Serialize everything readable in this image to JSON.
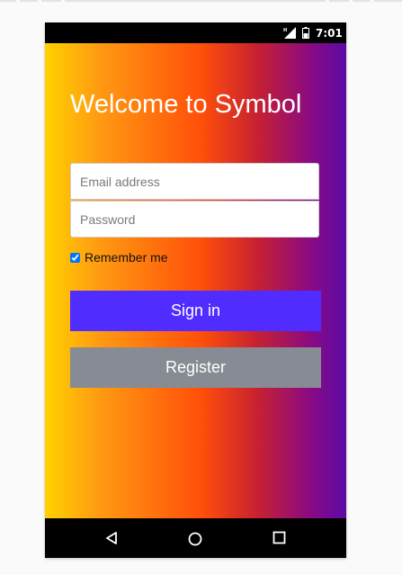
{
  "status_bar": {
    "time": "7:01",
    "icons": [
      "signal-icon",
      "battery-icon"
    ]
  },
  "login": {
    "title": "Welcome to Symbol",
    "email_placeholder": "Email address",
    "password_placeholder": "Password",
    "remember_label": "Remember me",
    "remember_checked": true,
    "signin_label": "Sign in",
    "register_label": "Register"
  },
  "navbar": {
    "icons": [
      "back-icon",
      "home-icon",
      "recents-icon"
    ]
  },
  "colors": {
    "gradient": [
      "#ffd200",
      "#ff4f0a",
      "#5b0aa6"
    ],
    "signin_button": "#512cff",
    "register_button": "#878b93"
  }
}
